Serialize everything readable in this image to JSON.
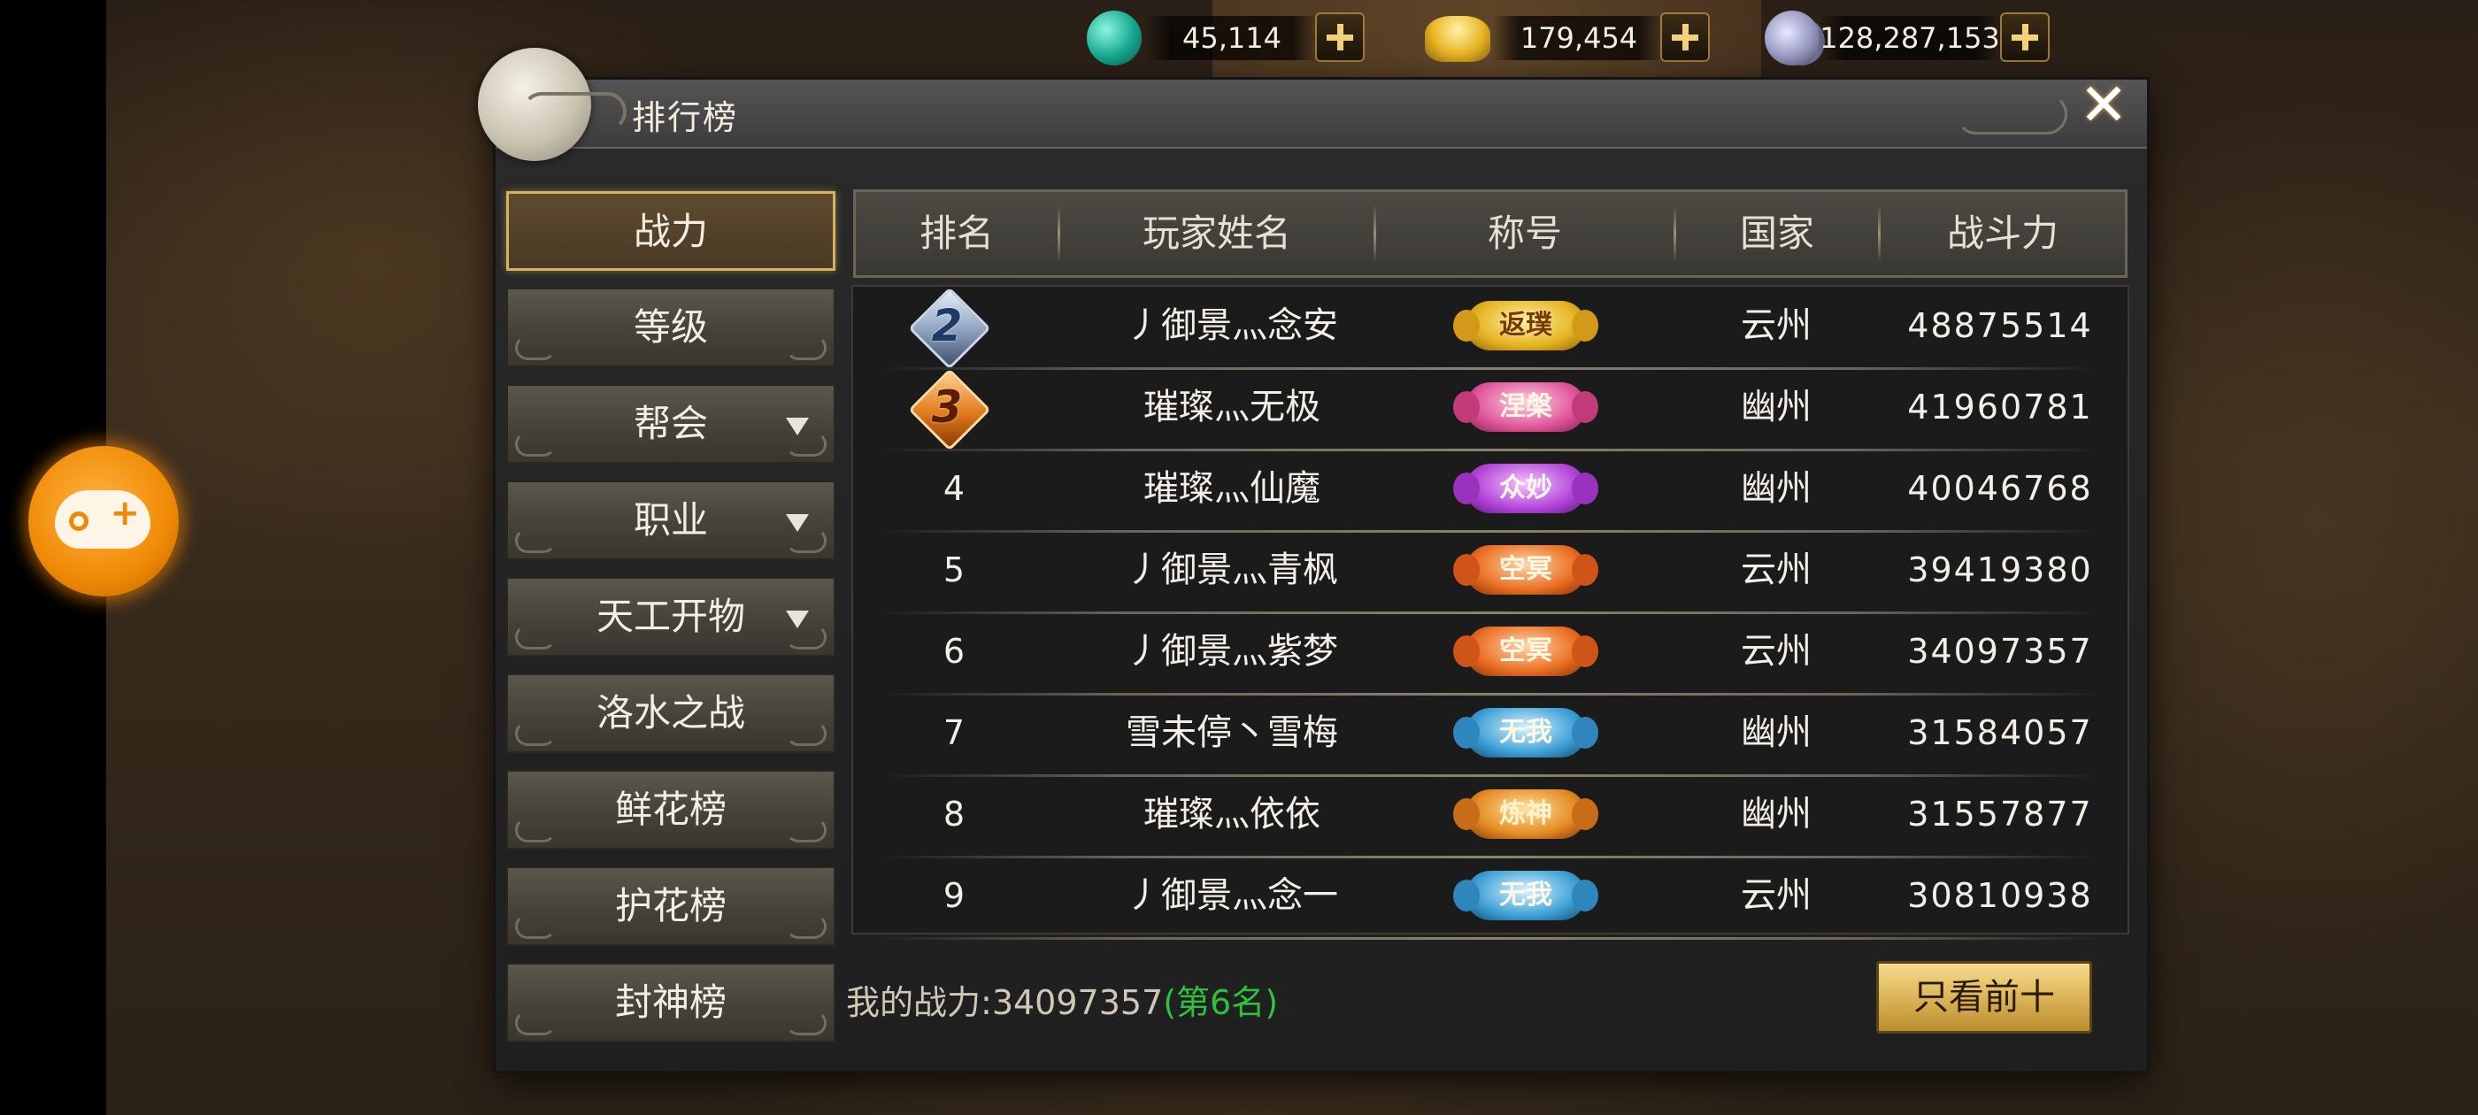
{
  "currencies": [
    {
      "icon": "jade-icon",
      "value": "45,114"
    },
    {
      "icon": "gold-ingot-icon",
      "value": "179,454"
    },
    {
      "icon": "silver-coin-icon",
      "value": "128,287,153"
    }
  ],
  "panel": {
    "title": "排行榜"
  },
  "tabs": [
    {
      "label": "战力",
      "active": true,
      "has_dropdown": false
    },
    {
      "label": "等级",
      "active": false,
      "has_dropdown": false
    },
    {
      "label": "帮会",
      "active": false,
      "has_dropdown": true
    },
    {
      "label": "职业",
      "active": false,
      "has_dropdown": true
    },
    {
      "label": "天工开物",
      "active": false,
      "has_dropdown": true
    },
    {
      "label": "洛水之战",
      "active": false,
      "has_dropdown": false
    },
    {
      "label": "鲜花榜",
      "active": false,
      "has_dropdown": false
    },
    {
      "label": "护花榜",
      "active": false,
      "has_dropdown": false
    },
    {
      "label": "封神榜",
      "active": false,
      "has_dropdown": false
    }
  ],
  "table": {
    "headers": [
      "排名",
      "玩家姓名",
      "称号",
      "国家",
      "战斗力"
    ],
    "rows": [
      {
        "rank": "2",
        "rank_badge": "silver",
        "name": "丿御景灬念安",
        "title": "返璞",
        "title_style": "gold",
        "country": "云州",
        "power": "48875514"
      },
      {
        "rank": "3",
        "rank_badge": "bronze",
        "name": "璀璨灬无极",
        "title": "涅槃",
        "title_style": "pink",
        "country": "幽州",
        "power": "41960781"
      },
      {
        "rank": "4",
        "rank_badge": "",
        "name": "璀璨灬仙魔",
        "title": "众妙",
        "title_style": "purple",
        "country": "幽州",
        "power": "40046768"
      },
      {
        "rank": "5",
        "rank_badge": "",
        "name": "丿御景灬青枫",
        "title": "空冥",
        "title_style": "orange",
        "country": "云州",
        "power": "39419380"
      },
      {
        "rank": "6",
        "rank_badge": "",
        "name": "丿御景灬紫梦",
        "title": "空冥",
        "title_style": "orange",
        "country": "云州",
        "power": "34097357"
      },
      {
        "rank": "7",
        "rank_badge": "",
        "name": "雪未停丶雪梅",
        "title": "无我",
        "title_style": "blue",
        "country": "幽州",
        "power": "31584057"
      },
      {
        "rank": "8",
        "rank_badge": "",
        "name": "璀璨灬依依",
        "title": "炼神",
        "title_style": "fire",
        "country": "幽州",
        "power": "31557877"
      },
      {
        "rank": "9",
        "rank_badge": "",
        "name": "丿御景灬念一",
        "title": "无我",
        "title_style": "blue",
        "country": "云州",
        "power": "30810938"
      }
    ]
  },
  "footer": {
    "my_power_label": "我的战力:",
    "my_power_value": "34097357",
    "my_rank": "(第6名)",
    "top10_button": "只看前十"
  },
  "colors": {
    "accent_gold": "#d6b25c",
    "rank_green": "#2ec23c",
    "side_button_orange": "#f08a06"
  }
}
